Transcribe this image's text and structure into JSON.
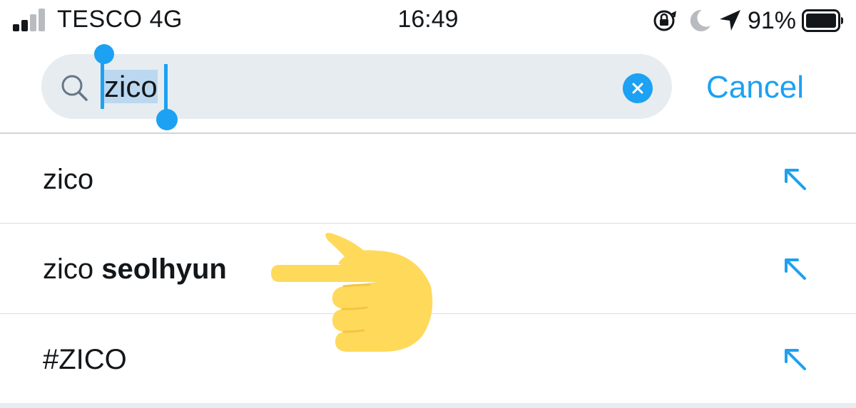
{
  "status_bar": {
    "carrier": "TESCO 4G",
    "time": "16:49",
    "battery": "91%",
    "icons": [
      "signal-icon",
      "orientation-lock-icon",
      "moon-icon",
      "location-arrow-icon",
      "battery-icon"
    ]
  },
  "search": {
    "query": "zico",
    "cancel_label": "Cancel"
  },
  "suggestions": [
    {
      "text": "zico",
      "bold": ""
    },
    {
      "text": "zico ",
      "bold": "seolhyun"
    },
    {
      "text": "#ZICO",
      "bold": ""
    }
  ],
  "colors": {
    "accent": "#1da1f2",
    "search_bg": "#e6ecf0",
    "selection": "#bcd8f0",
    "emoji_hand": "#ffd95a"
  }
}
